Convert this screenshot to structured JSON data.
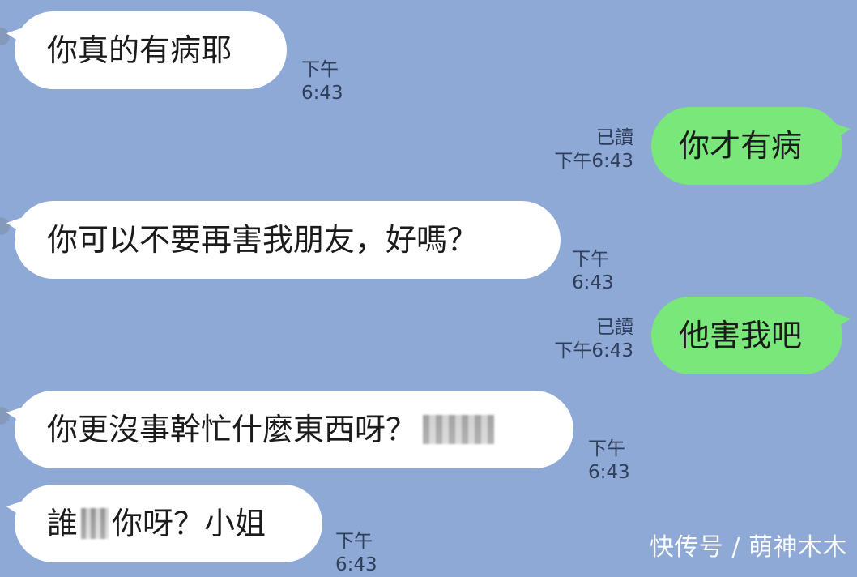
{
  "messages": [
    {
      "direction": "incoming",
      "text": "你真的有病耶",
      "time": "下午6:43"
    },
    {
      "direction": "outgoing",
      "text": "你才有病",
      "read": "已讀",
      "time": "下午6:43"
    },
    {
      "direction": "incoming",
      "text": "你可以不要再害我朋友，好嗎？",
      "time": "下午6:43"
    },
    {
      "direction": "outgoing",
      "text": "他害我吧",
      "read": "已讀",
      "time": "下午6:43"
    },
    {
      "direction": "incoming",
      "text": "你更沒事幹忙什麼東西呀？",
      "time": "下午6:43"
    },
    {
      "direction": "incoming",
      "text_before": "誰",
      "text_after": "你呀？小姐",
      "time": "下午6:43"
    }
  ],
  "watermark": "快传号 / 萌神木木"
}
